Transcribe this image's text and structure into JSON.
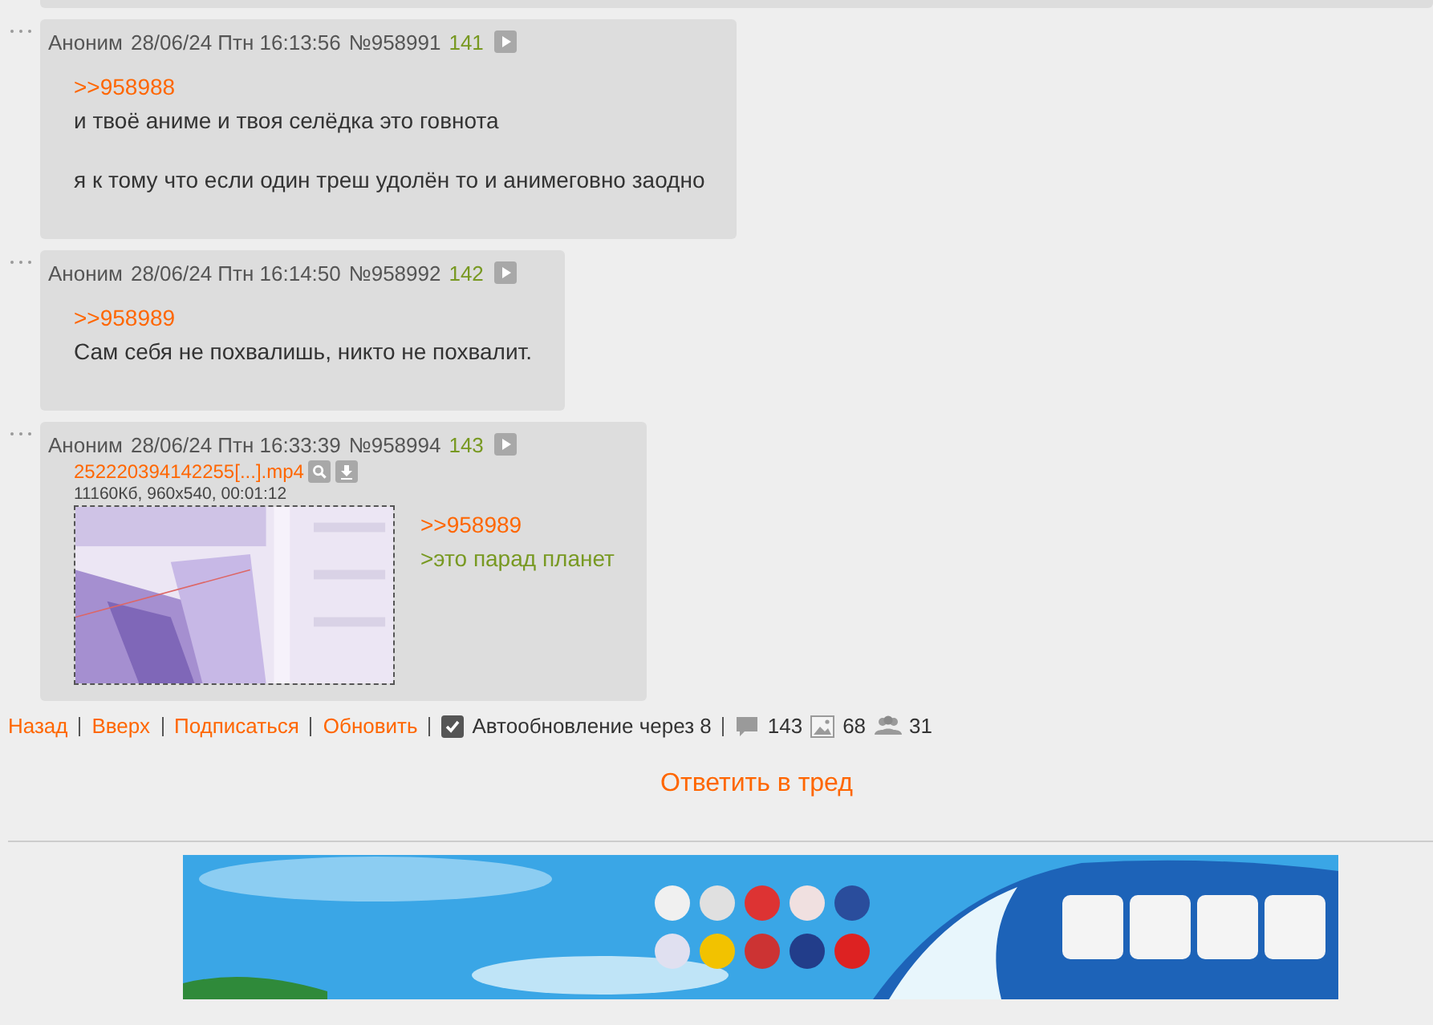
{
  "posts": [
    {
      "author": "Аноним",
      "date": "28/06/24 Птн 16:13:56",
      "number": "№958991",
      "index": "141",
      "paragraphs": [
        [
          {
            "kind": "reply-link",
            "text": ">>958988"
          },
          {
            "kind": "text",
            "text": "и твоё аниме и твоя селёдка это говнота"
          }
        ],
        [
          {
            "kind": "text",
            "text": "я к тому что если один треш удолён то и анимеговно заодно"
          }
        ]
      ]
    },
    {
      "author": "Аноним",
      "date": "28/06/24 Птн 16:14:50",
      "number": "№958992",
      "index": "142",
      "paragraphs": [
        [
          {
            "kind": "reply-link",
            "text": ">>958989"
          },
          {
            "kind": "text",
            "text": "Сам себя не похвалишь, никто не похвалит."
          }
        ]
      ]
    },
    {
      "author": "Аноним",
      "date": "28/06/24 Птн 16:33:39",
      "number": "№958994",
      "index": "143",
      "file": {
        "name": "252220394142255[...].mp4",
        "info": "11160Кб, 960x540, 00:01:12"
      },
      "paragraphs": [
        [
          {
            "kind": "reply-link",
            "text": ">>958989"
          },
          {
            "kind": "greentext",
            "text": ">это парад планет"
          }
        ]
      ]
    }
  ],
  "nav": [
    "Назад",
    "Вверх",
    "Подписаться",
    "Обновить"
  ],
  "autoupdate": {
    "checked": true,
    "label": "Автообновление через 8"
  },
  "stats": {
    "posts": "143",
    "files": "68",
    "posters": "31"
  },
  "reply_button": "Ответить в тред"
}
